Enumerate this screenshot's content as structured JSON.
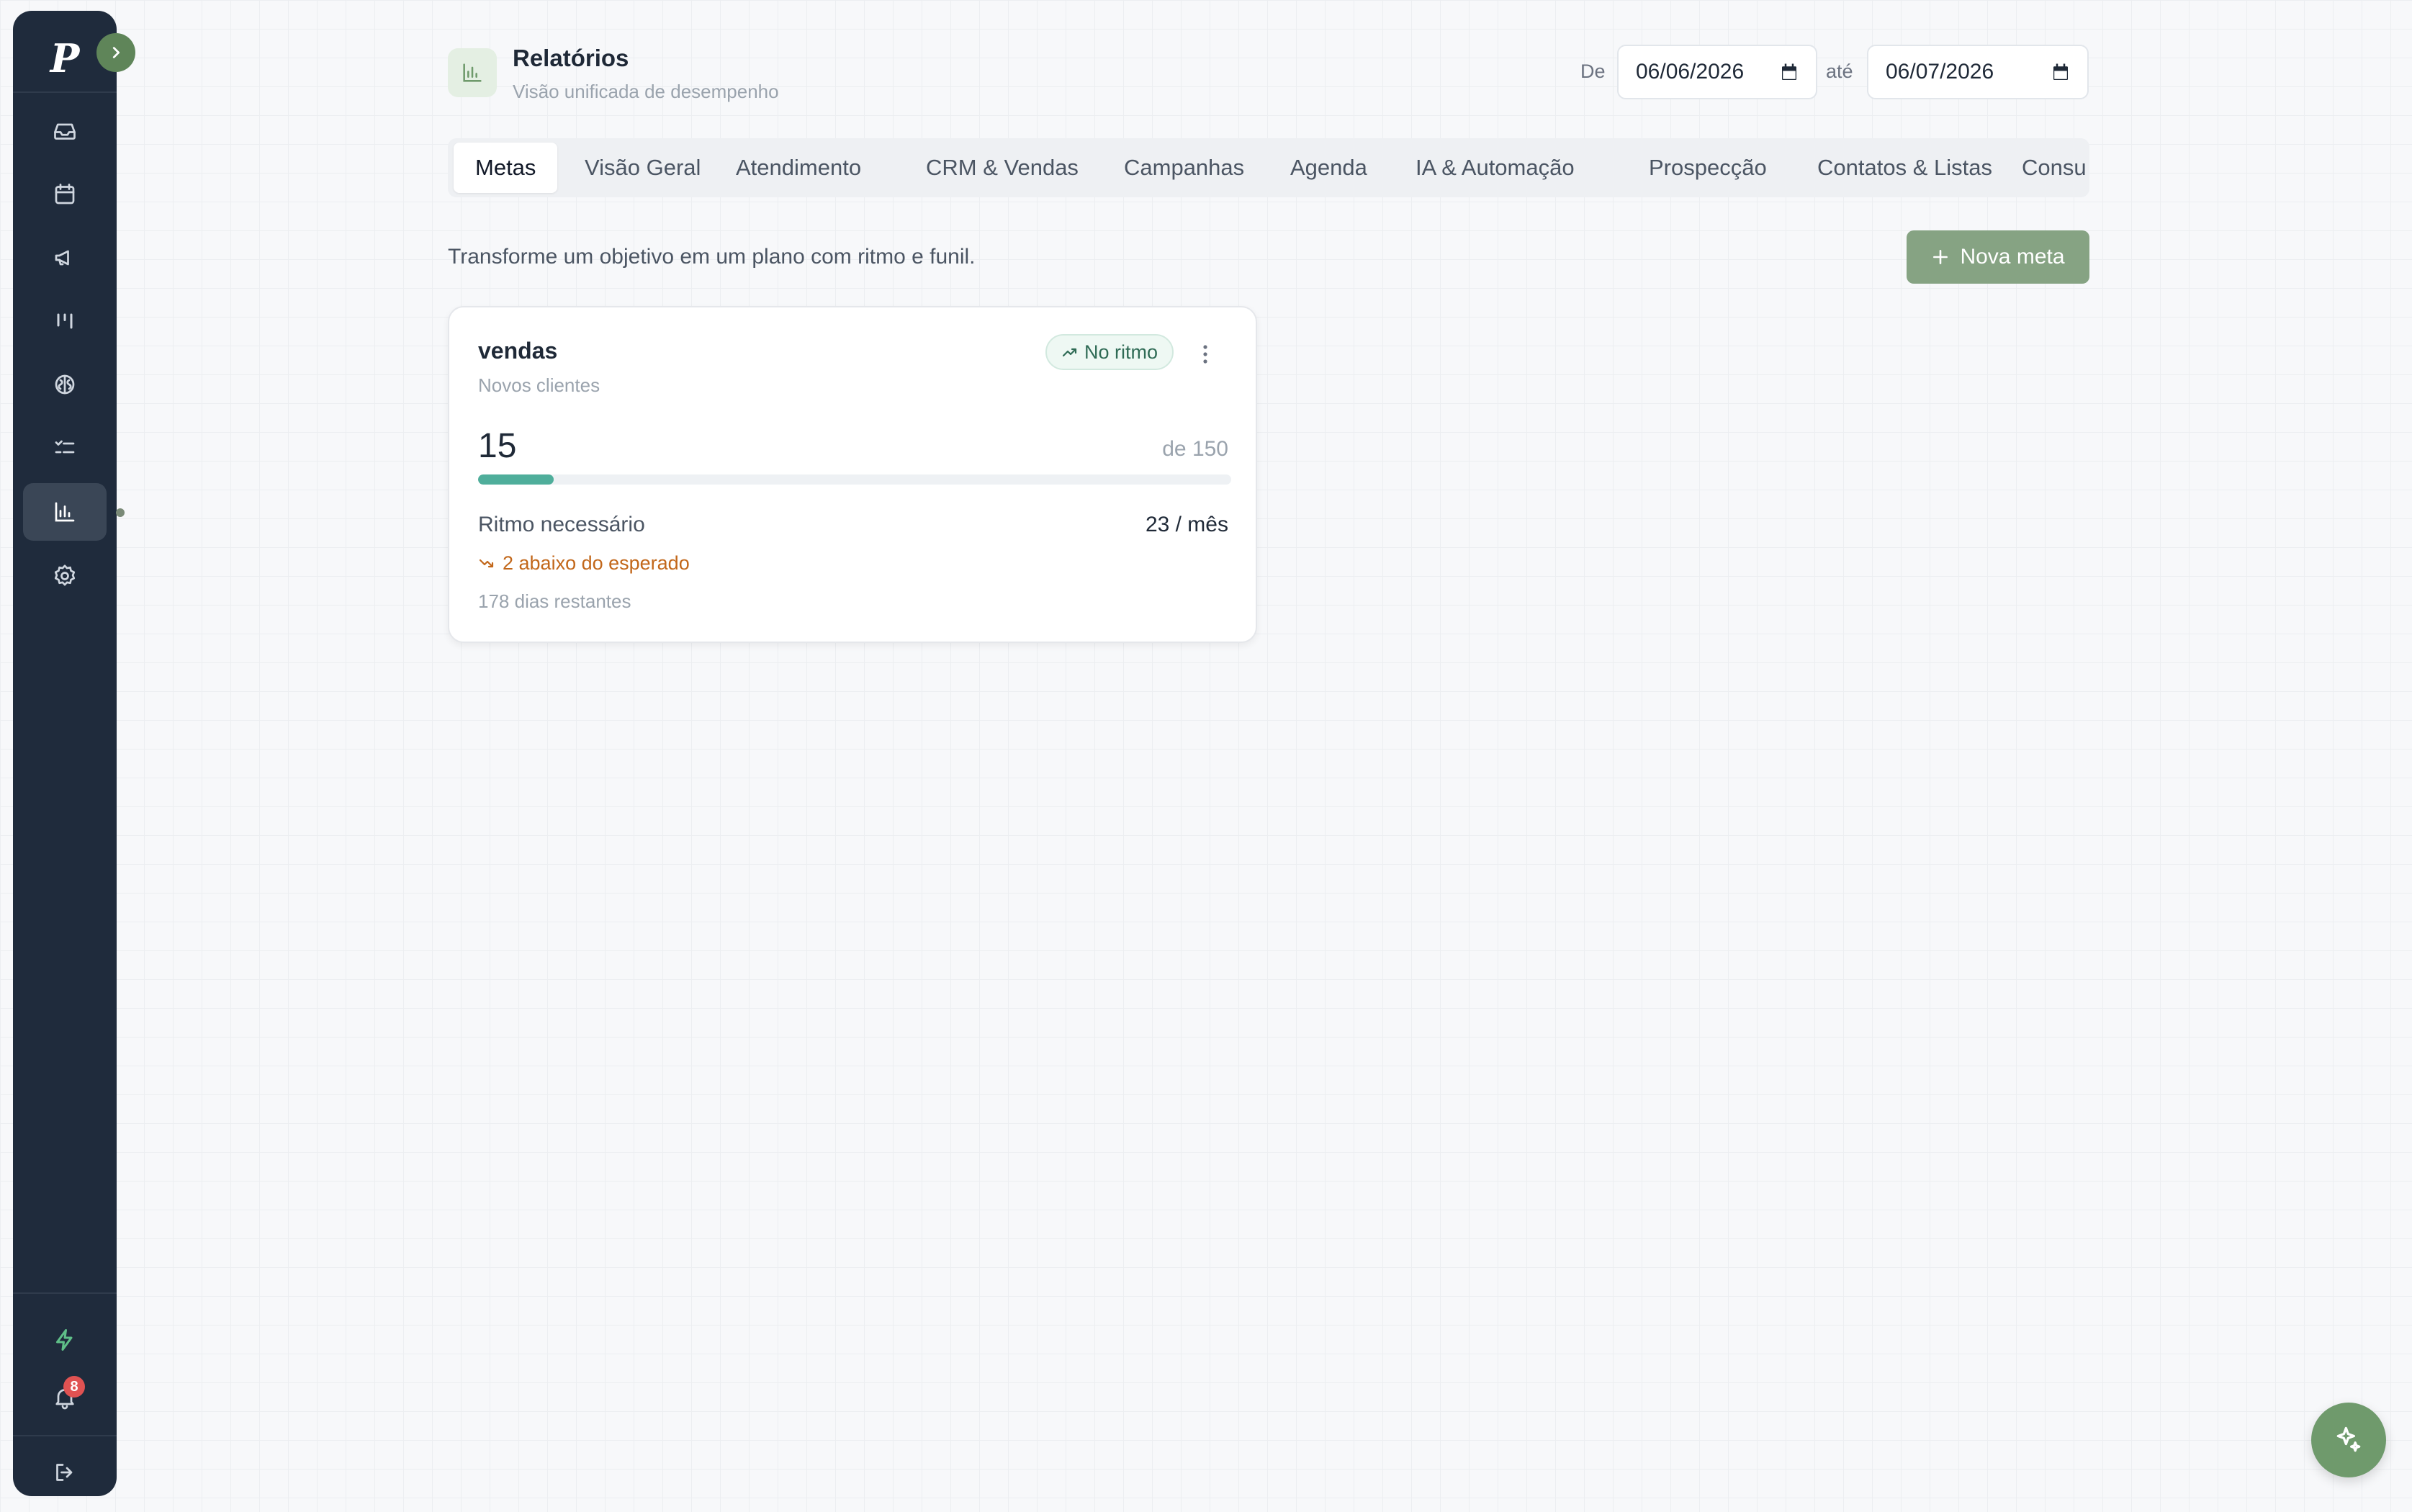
{
  "sidebar": {
    "logo": "P",
    "items": [
      {
        "icon": "inbox-icon"
      },
      {
        "icon": "calendar-icon"
      },
      {
        "icon": "megaphone-icon"
      },
      {
        "icon": "kanban-icon"
      },
      {
        "icon": "brain-icon"
      },
      {
        "icon": "checklist-icon"
      },
      {
        "icon": "bar-chart-icon",
        "active": true
      },
      {
        "icon": "gear-icon"
      }
    ],
    "bottom": [
      {
        "icon": "lightning-icon"
      },
      {
        "icon": "bell-icon",
        "badge": "8"
      },
      {
        "icon": "logout-icon"
      }
    ]
  },
  "header": {
    "title": "Relatórios",
    "subtitle": "Visão unificada de desempenho",
    "from_label": "De",
    "from_date": "06/06/2026",
    "to_label": "até",
    "to_date": "06/07/2026"
  },
  "tabs": [
    {
      "label": "Metas",
      "active": true
    },
    {
      "label": "Visão Geral"
    },
    {
      "label": "Atendimento"
    },
    {
      "label": "CRM & Vendas"
    },
    {
      "label": "Campanhas"
    },
    {
      "label": "Agenda"
    },
    {
      "label": "IA & Automação"
    },
    {
      "label": "Prospecção"
    },
    {
      "label": "Contatos & Listas"
    },
    {
      "label": "Consu"
    }
  ],
  "toolbar": {
    "helper_text": "Transforme um objetivo em um plano com ritmo e funil.",
    "new_goal_label": "Nova meta"
  },
  "goal_card": {
    "title": "vendas",
    "subtitle": "Novos clientes",
    "status": "No ritmo",
    "current": "15",
    "target_text": "de 150",
    "progress_fraction": 0.1,
    "pace_label": "Ritmo necessário",
    "pace_value": "23 / mês",
    "below_text": "2 abaixo do esperado",
    "days_left": "178 dias restantes"
  },
  "colors": {
    "sidebar_bg": "#1f2b3c",
    "accent": "#86a383",
    "progress": "#4fae9b",
    "warning": "#c2671a",
    "badge": "#e05252"
  }
}
